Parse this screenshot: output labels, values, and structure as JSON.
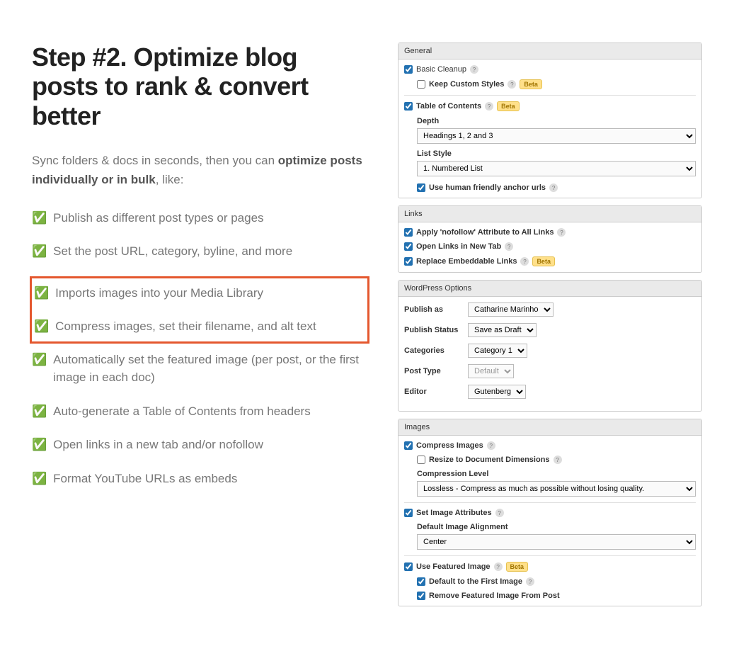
{
  "heading": "Step #2. Optimize blog posts to rank & convert better",
  "subtext_prefix": "Sync folders & docs in seconds, then you can ",
  "subtext_bold": "optimize posts individually or in bulk",
  "subtext_suffix": ", like:",
  "checklist": {
    "item1": "Publish as different post types or pages",
    "item2": "Set the post URL, category, byline, and more",
    "item3": "Imports images into your Media Library",
    "item4": "Compress images, set their filename, and alt text",
    "item5": "Automatically set the featured image (per post, or the first image in each doc)",
    "item6": "Auto-generate a Table of Contents from headers",
    "item7": "Open links in a new tab and/or nofollow",
    "item8": "Format YouTube URLs as embeds"
  },
  "panels": {
    "general": {
      "title": "General",
      "basic_cleanup": "Basic Cleanup",
      "keep_custom_styles": "Keep Custom Styles",
      "table_of_contents": "Table of Contents",
      "depth_label": "Depth",
      "depth_value": "Headings 1, 2 and 3",
      "list_style_label": "List Style",
      "list_style_value": "1.  Numbered List",
      "human_friendly": "Use human friendly anchor urls"
    },
    "links": {
      "title": "Links",
      "nofollow": "Apply 'nofollow' Attribute to All Links",
      "new_tab": "Open Links in New Tab",
      "replace_embed": "Replace Embeddable Links"
    },
    "wp": {
      "title": "WordPress Options",
      "publish_as_label": "Publish as",
      "publish_as_value": "Catharine Marinho",
      "publish_status_label": "Publish Status",
      "publish_status_value": "Save as Draft",
      "categories_label": "Categories",
      "categories_value": "Category 1",
      "post_type_label": "Post Type",
      "post_type_value": "Default",
      "editor_label": "Editor",
      "editor_value": "Gutenberg"
    },
    "images": {
      "title": "Images",
      "compress": "Compress Images",
      "resize": "Resize to Document Dimensions",
      "compression_level_label": "Compression Level",
      "compression_level_value": "Lossless - Compress as much as possible without losing quality.",
      "set_attrs": "Set Image Attributes",
      "default_align_label": "Default Image Alignment",
      "default_align_value": "Center",
      "use_featured": "Use Featured Image",
      "default_first": "Default to the First Image",
      "remove_featured": "Remove Featured Image From Post"
    }
  },
  "beta_label": "Beta",
  "help_icon": "?"
}
